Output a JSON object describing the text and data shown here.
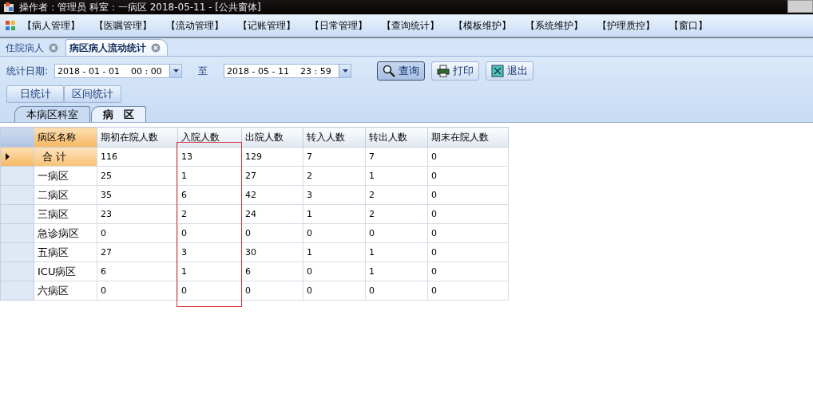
{
  "window": {
    "title": "操作者：管理员  科室：一病区  2018-05-11 - [公共窗体]"
  },
  "menu": [
    "【病人管理】",
    "【医嘱管理】",
    "【流动管理】",
    "【记账管理】",
    "【日常管理】",
    "【查询统计】",
    "【模板维护】",
    "【系统维护】",
    "【护理质控】",
    "【窗口】"
  ],
  "doc_tabs": [
    {
      "label": "住院病人",
      "selected": false
    },
    {
      "label": "病区病人流动统计",
      "selected": true
    }
  ],
  "filter": {
    "label": "统计日期:",
    "from": "2018 - 01 - 01    00 : 00",
    "to_label": "至",
    "to": "2018 - 05 - 11    23 : 59"
  },
  "buttons": [
    {
      "kind": "search",
      "label": "查询",
      "selected": true
    },
    {
      "kind": "print",
      "label": "打印",
      "selected": false
    },
    {
      "kind": "exit",
      "label": "退出",
      "selected": false
    }
  ],
  "mode_buttons": [
    "日统计",
    "区间统计"
  ],
  "sheet_tabs": [
    {
      "label": "本病区科室",
      "selected": false
    },
    {
      "label": "病　区",
      "selected": true
    }
  ],
  "table": {
    "columns": [
      {
        "label": "病区名称",
        "highlighted": false
      },
      {
        "label": "期初在院人数",
        "highlighted": false
      },
      {
        "label": "入院人数",
        "highlighted": true
      },
      {
        "label": "出院人数",
        "highlighted": false
      },
      {
        "label": "转入人数",
        "highlighted": false
      },
      {
        "label": "转出人数",
        "highlighted": false
      },
      {
        "label": "期末在院人数",
        "highlighted": false
      }
    ],
    "rows": [
      {
        "selected": true,
        "cells": [
          "合 计",
          "116",
          "13",
          "129",
          "7",
          "7",
          "0"
        ]
      },
      {
        "selected": false,
        "cells": [
          "一病区",
          "25",
          "1",
          "27",
          "2",
          "1",
          "0"
        ]
      },
      {
        "selected": false,
        "cells": [
          "二病区",
          "35",
          "6",
          "42",
          "3",
          "2",
          "0"
        ]
      },
      {
        "selected": false,
        "cells": [
          "三病区",
          "23",
          "2",
          "24",
          "1",
          "2",
          "0"
        ]
      },
      {
        "selected": false,
        "cells": [
          "急诊病区",
          "0",
          "0",
          "0",
          "0",
          "0",
          "0"
        ]
      },
      {
        "selected": false,
        "cells": [
          "五病区",
          "27",
          "3",
          "30",
          "1",
          "1",
          "0"
        ]
      },
      {
        "selected": false,
        "cells": [
          "ICU病区",
          "6",
          "1",
          "6",
          "0",
          "1",
          "0"
        ]
      },
      {
        "selected": false,
        "cells": [
          "六病区",
          "0",
          "0",
          "0",
          "0",
          "0",
          "0"
        ]
      }
    ]
  }
}
